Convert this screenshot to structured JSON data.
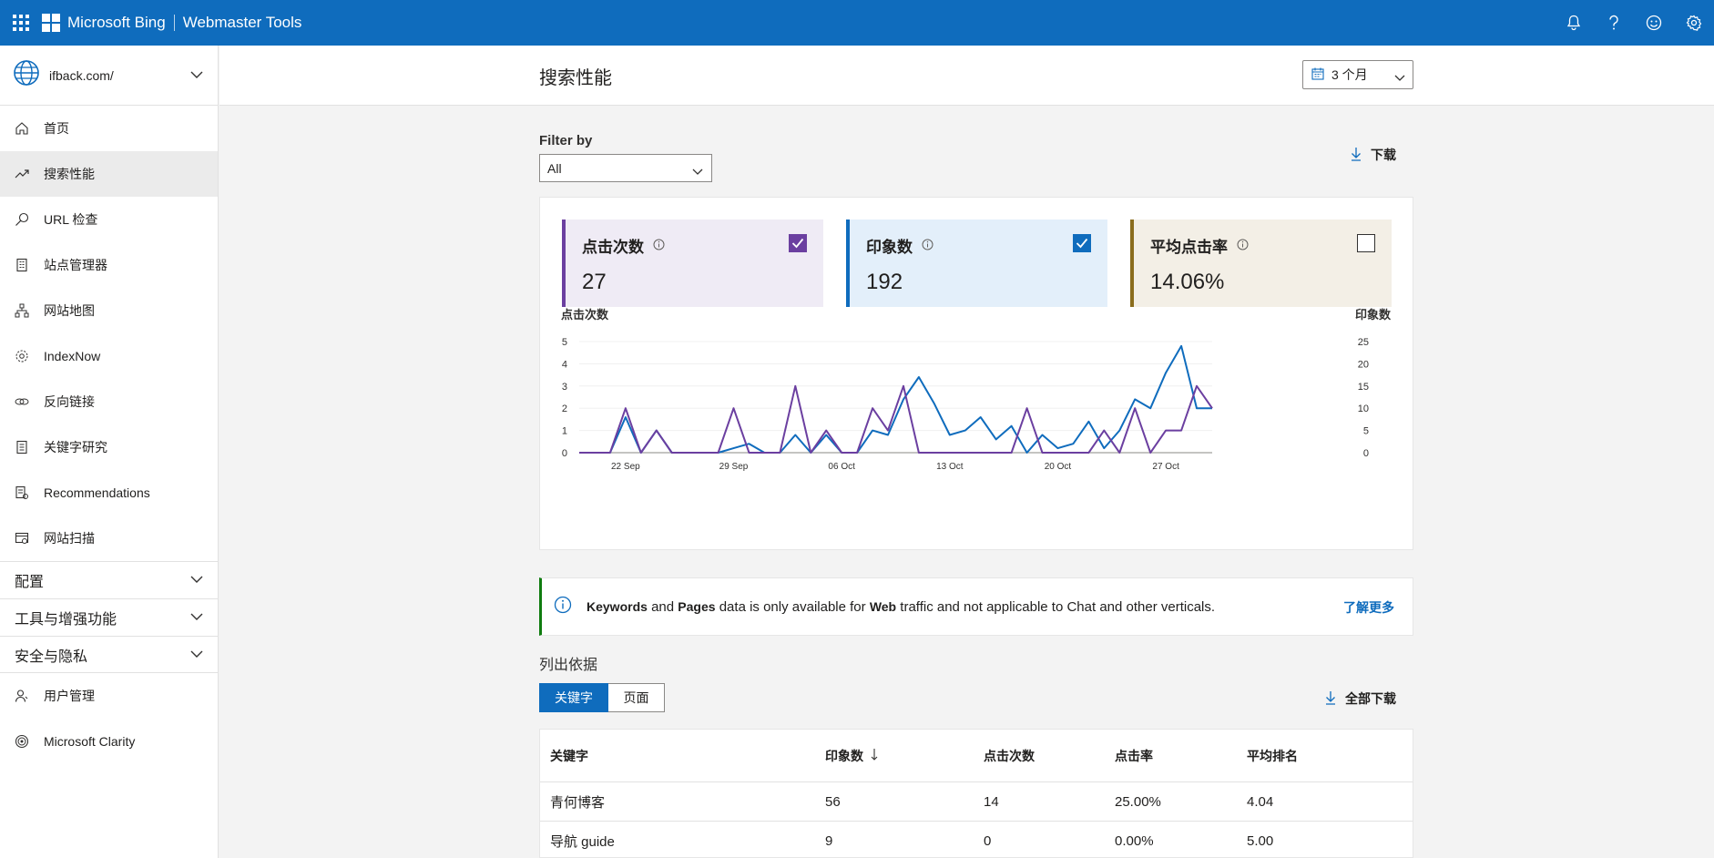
{
  "topbar": {
    "brand": "Microsoft Bing",
    "product": "Webmaster Tools",
    "icons": [
      "bell-icon",
      "help-icon",
      "smiley-icon",
      "settings-icon"
    ]
  },
  "sidebar": {
    "site": "ifback.com/",
    "items": [
      {
        "label": "首页",
        "icon": "home-icon"
      },
      {
        "label": "搜索性能",
        "icon": "trend-icon",
        "active": true
      },
      {
        "label": "URL 检查",
        "icon": "search-icon"
      },
      {
        "label": "站点管理器",
        "icon": "building-icon"
      },
      {
        "label": "网站地图",
        "icon": "sitemap-icon"
      },
      {
        "label": "IndexNow",
        "icon": "gear-icon"
      },
      {
        "label": "反向链接",
        "icon": "link-icon"
      },
      {
        "label": "关键字研究",
        "icon": "document-icon"
      },
      {
        "label": "Recommendations",
        "icon": "recommend-icon"
      },
      {
        "label": "网站扫描",
        "icon": "scan-icon"
      }
    ],
    "groups": [
      "配置",
      "工具与增强功能",
      "安全与隐私"
    ],
    "bottom_items": [
      {
        "label": "用户管理",
        "icon": "user-icon"
      },
      {
        "label": "Microsoft Clarity",
        "icon": "clarity-icon"
      }
    ]
  },
  "header": {
    "title": "搜索性能",
    "range": "3 个月"
  },
  "filter": {
    "label": "Filter by",
    "value": "All"
  },
  "download_label": "下载",
  "metrics": [
    {
      "label": "点击次数",
      "value": "27",
      "checked": true,
      "color": "#6b3fa0",
      "bg": "#efebf5"
    },
    {
      "label": "印象数",
      "value": "192",
      "checked": true,
      "color": "#0f6cbd",
      "bg": "#e3effa"
    },
    {
      "label": "平均点击率",
      "value": "14.06%",
      "checked": false,
      "color": "#8a6d1d",
      "bg": "#f3efe6"
    }
  ],
  "chart_data": {
    "type": "line",
    "ylabel_left": "点击次数",
    "ylabel_right": "印象数",
    "yticks_left": [
      "0",
      "1",
      "2",
      "3",
      "4",
      "5"
    ],
    "yticks_right": [
      "0",
      "5",
      "10",
      "15",
      "20",
      "25"
    ],
    "xticks": [
      "22 Sep",
      "29 Sep",
      "06 Oct",
      "13 Oct",
      "20 Oct",
      "27 Oct"
    ],
    "ylim_left": [
      0,
      5
    ],
    "ylim_right": [
      0,
      25
    ],
    "grid": true,
    "series": [
      {
        "name": "点击次数",
        "axis": "left",
        "color": "#6b3fa0",
        "values": [
          0,
          0,
          0,
          2,
          0,
          1,
          0,
          0,
          0,
          0,
          2,
          0,
          0,
          0,
          3,
          0,
          1,
          0,
          0,
          2,
          1,
          3,
          0,
          0,
          0,
          0,
          0,
          0,
          0,
          2,
          0,
          0,
          0,
          0,
          1,
          0,
          2,
          0,
          1,
          1,
          3,
          2
        ]
      },
      {
        "name": "印象数",
        "axis": "right",
        "color": "#0f6cbd",
        "values": [
          0,
          0,
          0,
          8,
          0,
          5,
          0,
          0,
          0,
          0,
          1,
          2,
          0,
          0,
          4,
          0,
          4,
          0,
          0,
          5,
          4,
          12,
          17,
          11,
          4,
          5,
          8,
          3,
          6,
          0,
          4,
          1,
          2,
          7,
          1,
          5,
          12,
          10,
          18,
          24,
          10,
          10
        ]
      }
    ]
  },
  "banner": {
    "b1": "Keywords",
    "t1": " and ",
    "b2": "Pages",
    "t2": " data is only available for ",
    "b3": "Web",
    "t3": " traffic and not applicable to Chat and other verticals.",
    "link": "了解更多"
  },
  "list_by": "列出依据",
  "tabs": [
    "关键字",
    "页面"
  ],
  "download_all": "全部下载",
  "table": {
    "headers": [
      "关键字",
      "印象数",
      "点击次数",
      "点击率",
      "平均排名"
    ],
    "rows": [
      [
        "青何博客",
        "56",
        "14",
        "25.00%",
        "4.04"
      ],
      [
        "导航 guide",
        "9",
        "0",
        "0.00%",
        "5.00"
      ]
    ]
  }
}
